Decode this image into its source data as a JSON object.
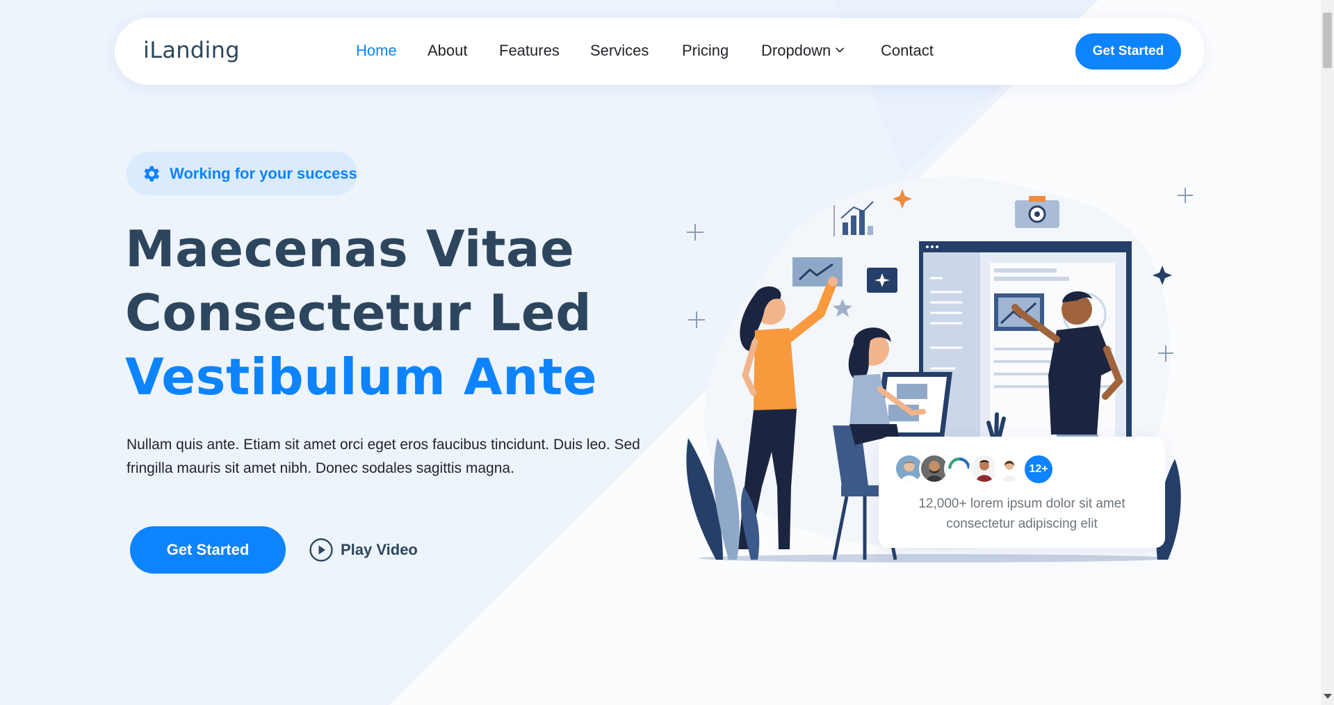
{
  "brand": {
    "name": "iLanding"
  },
  "nav": {
    "items": [
      {
        "label": "Home",
        "active": true
      },
      {
        "label": "About",
        "active": false
      },
      {
        "label": "Features",
        "active": false
      },
      {
        "label": "Services",
        "active": false
      },
      {
        "label": "Pricing",
        "active": false
      },
      {
        "label": "Dropdown",
        "active": false,
        "has_dropdown": true
      },
      {
        "label": "Contact",
        "active": false
      }
    ],
    "cta_label": "Get Started"
  },
  "hero": {
    "badge_icon": "gear-icon",
    "badge_text": "Working for your success",
    "title_line1": "Maecenas Vitae",
    "title_line2": "Consectetur Led",
    "title_line3": "Vestibulum Ante",
    "description": "Nullam quis ante. Etiam sit amet orci eget eros faucibus tincidunt. Duis leo. Sed fringilla mauris sit amet nibh. Donec sodales sagittis magna.",
    "cta_label": "Get Started",
    "video_label": "Play Video"
  },
  "customers": {
    "more_badge": "12+",
    "text": "12,000+ lorem ipsum dolor sit amet consectetur adipiscing elit"
  },
  "colors": {
    "accent": "#0d83fd",
    "heading": "#2d465e",
    "background": "#eef4fc"
  }
}
